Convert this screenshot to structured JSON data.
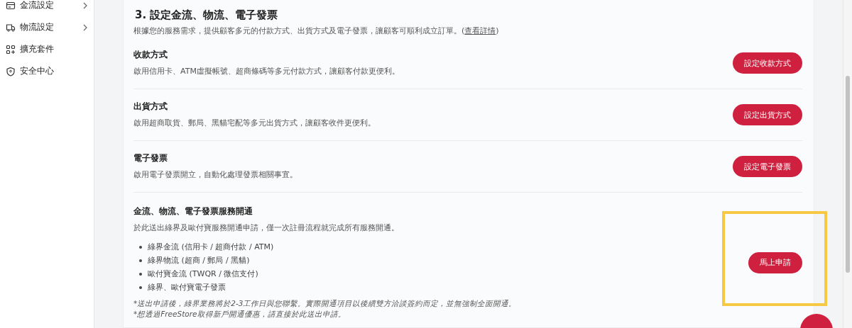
{
  "sidebar": {
    "items": [
      {
        "label": "金流設定",
        "chevron": true
      },
      {
        "label": "物流設定",
        "chevron": true
      },
      {
        "label": "擴充套件",
        "chevron": false
      },
      {
        "label": "安全中心",
        "chevron": false
      }
    ]
  },
  "section": {
    "title": "3. 設定金流、物流、電子發票",
    "description": "根據您的服務需求，提供顧客多元的付款方式、出貨方式及電子發票，讓顧客可順利成立訂單。(",
    "link": "查看詳情",
    "description_end": ")"
  },
  "settings": [
    {
      "title": "收款方式",
      "description": "啟用信用卡、ATM虛擬帳號、超商條碼等多元付款方式，讓顧客付款更便利。",
      "button": "設定收款方式"
    },
    {
      "title": "出貨方式",
      "description": "啟用超商取貨、郵局、黑貓宅配等多元出貨方式，讓顧客收件更便利。",
      "button": "設定出貨方式"
    },
    {
      "title": "電子發票",
      "description": "啟用電子發票開立，自動化處理發票相關事宜。",
      "button": "設定電子發票"
    }
  ],
  "application": {
    "title": "金流、物流、電子發票服務開通",
    "description": "於此送出綠界及歐付寶服務開通申請，僅一次註冊流程就完成所有服務開通。",
    "bullets": [
      "綠界金流 (信用卡 / 超商付款 / ATM)",
      "綠界物流 (超商 / 郵局 / 黑貓)",
      "歐付寶金流 (TWQR / 微信支付)",
      "綠界、歐付寶電子發票"
    ],
    "notes": [
      "*送出申請後，綠界業務將於2-3工作日與您聯繫。實際開通項目以後續雙方洽談簽約而定，並無強制全面開通。",
      "*想透過FreeStore取得新戶開通優惠，請直接於此送出申請。"
    ],
    "button": "馬上申請",
    "highlighted": true
  }
}
